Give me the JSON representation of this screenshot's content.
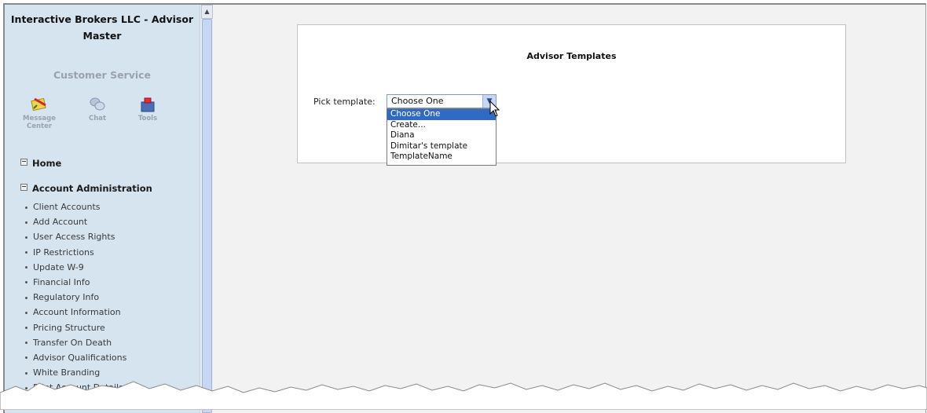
{
  "sidebar": {
    "app_title": "Interactive Brokers LLC - Advisor Master",
    "customer_service": "Customer Service",
    "tools": [
      {
        "label": "Message Center",
        "icon": "message-center-icon"
      },
      {
        "label": "Chat",
        "icon": "chat-icon"
      },
      {
        "label": "Tools",
        "icon": "tools-icon"
      }
    ],
    "home_label": "Home",
    "account_admin_label": "Account Administration",
    "items": [
      "Client Accounts",
      "Add Account",
      "User Access Rights",
      "IP Restrictions",
      "Update W-9",
      "Financial Info",
      "Regulatory Info",
      "Account Information",
      "Pricing Structure",
      "Transfer On Death",
      "Advisor Qualifications",
      "White Branding",
      "Print Account Details"
    ]
  },
  "main": {
    "panel_title": "Advisor Templates",
    "pick_label": "Pick template:",
    "select_value": "Choose One",
    "options": [
      "Choose One",
      "Create...",
      "Diana",
      "Dimitar's template",
      "TemplateName"
    ]
  }
}
